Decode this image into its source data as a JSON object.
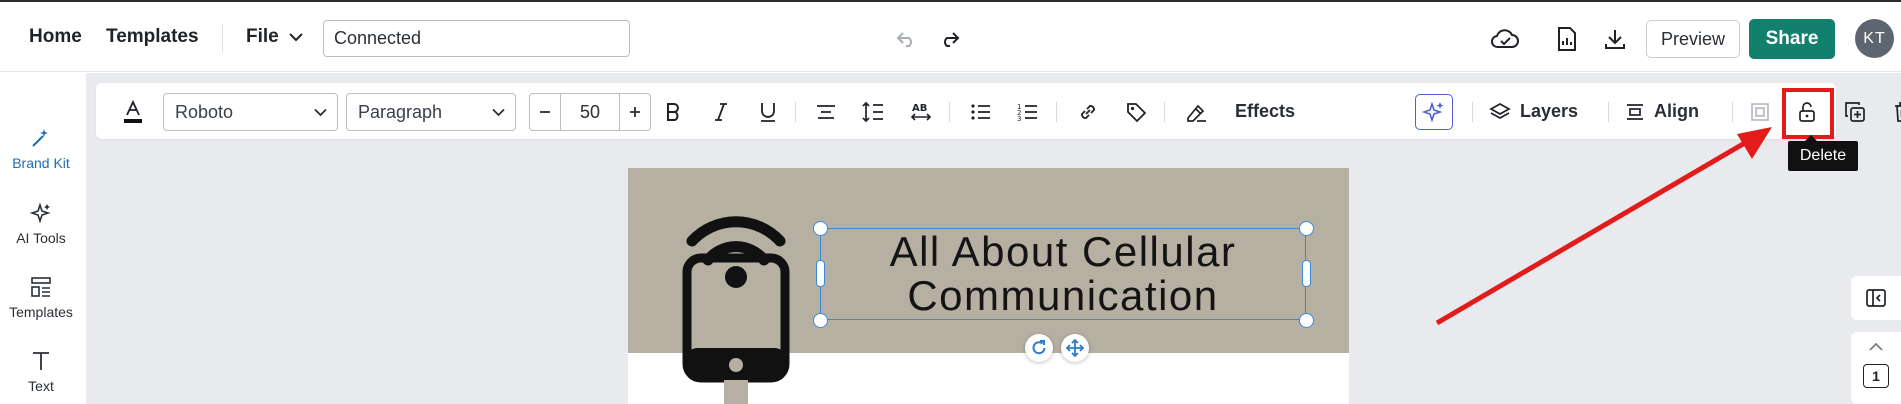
{
  "header": {
    "nav": [
      {
        "label": "Home"
      },
      {
        "label": "Templates"
      }
    ],
    "file_label": "File",
    "title_value": "Connected",
    "preview_label": "Preview",
    "share_label": "Share",
    "avatar_initials": "KT"
  },
  "sidebar": {
    "items": [
      {
        "label": "Brand Kit",
        "icon": "magic-wand-icon"
      },
      {
        "label": "AI Tools",
        "icon": "sparkles-icon"
      },
      {
        "label": "Templates",
        "icon": "templates-grid-icon"
      },
      {
        "label": "Text",
        "icon": "text-t-icon"
      }
    ]
  },
  "toolbar": {
    "font_family": "Roboto",
    "text_style": "Paragraph",
    "font_size": "50",
    "effects_label": "Effects",
    "layers_label": "Layers",
    "align_label": "Align",
    "tooltip": "Delete"
  },
  "canvas": {
    "headline": "All About Cellular Communication"
  },
  "right_panel": {
    "page_number": "1"
  },
  "colors": {
    "accent_share": "#137f6d",
    "banner": "#b6b0a3",
    "selection": "#3a8ad6",
    "highlight": "#e21b1b"
  }
}
